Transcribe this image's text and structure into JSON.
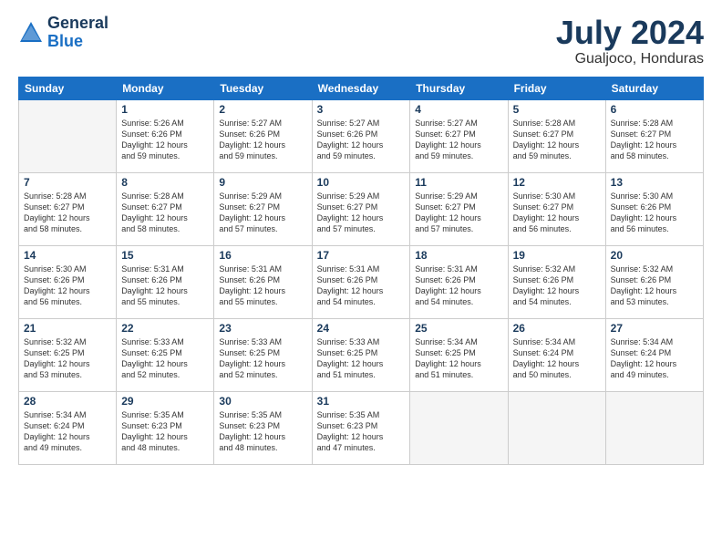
{
  "logo": {
    "general": "General",
    "blue": "Blue"
  },
  "title": {
    "month": "July 2024",
    "location": "Gualjoco, Honduras"
  },
  "weekdays": [
    "Sunday",
    "Monday",
    "Tuesday",
    "Wednesday",
    "Thursday",
    "Friday",
    "Saturday"
  ],
  "weeks": [
    [
      {
        "day": "",
        "info": ""
      },
      {
        "day": "1",
        "info": "Sunrise: 5:26 AM\nSunset: 6:26 PM\nDaylight: 12 hours\nand 59 minutes."
      },
      {
        "day": "2",
        "info": "Sunrise: 5:27 AM\nSunset: 6:26 PM\nDaylight: 12 hours\nand 59 minutes."
      },
      {
        "day": "3",
        "info": "Sunrise: 5:27 AM\nSunset: 6:26 PM\nDaylight: 12 hours\nand 59 minutes."
      },
      {
        "day": "4",
        "info": "Sunrise: 5:27 AM\nSunset: 6:27 PM\nDaylight: 12 hours\nand 59 minutes."
      },
      {
        "day": "5",
        "info": "Sunrise: 5:28 AM\nSunset: 6:27 PM\nDaylight: 12 hours\nand 59 minutes."
      },
      {
        "day": "6",
        "info": "Sunrise: 5:28 AM\nSunset: 6:27 PM\nDaylight: 12 hours\nand 58 minutes."
      }
    ],
    [
      {
        "day": "7",
        "info": "Sunrise: 5:28 AM\nSunset: 6:27 PM\nDaylight: 12 hours\nand 58 minutes."
      },
      {
        "day": "8",
        "info": "Sunrise: 5:28 AM\nSunset: 6:27 PM\nDaylight: 12 hours\nand 58 minutes."
      },
      {
        "day": "9",
        "info": "Sunrise: 5:29 AM\nSunset: 6:27 PM\nDaylight: 12 hours\nand 57 minutes."
      },
      {
        "day": "10",
        "info": "Sunrise: 5:29 AM\nSunset: 6:27 PM\nDaylight: 12 hours\nand 57 minutes."
      },
      {
        "day": "11",
        "info": "Sunrise: 5:29 AM\nSunset: 6:27 PM\nDaylight: 12 hours\nand 57 minutes."
      },
      {
        "day": "12",
        "info": "Sunrise: 5:30 AM\nSunset: 6:27 PM\nDaylight: 12 hours\nand 56 minutes."
      },
      {
        "day": "13",
        "info": "Sunrise: 5:30 AM\nSunset: 6:26 PM\nDaylight: 12 hours\nand 56 minutes."
      }
    ],
    [
      {
        "day": "14",
        "info": "Sunrise: 5:30 AM\nSunset: 6:26 PM\nDaylight: 12 hours\nand 56 minutes."
      },
      {
        "day": "15",
        "info": "Sunrise: 5:31 AM\nSunset: 6:26 PM\nDaylight: 12 hours\nand 55 minutes."
      },
      {
        "day": "16",
        "info": "Sunrise: 5:31 AM\nSunset: 6:26 PM\nDaylight: 12 hours\nand 55 minutes."
      },
      {
        "day": "17",
        "info": "Sunrise: 5:31 AM\nSunset: 6:26 PM\nDaylight: 12 hours\nand 54 minutes."
      },
      {
        "day": "18",
        "info": "Sunrise: 5:31 AM\nSunset: 6:26 PM\nDaylight: 12 hours\nand 54 minutes."
      },
      {
        "day": "19",
        "info": "Sunrise: 5:32 AM\nSunset: 6:26 PM\nDaylight: 12 hours\nand 54 minutes."
      },
      {
        "day": "20",
        "info": "Sunrise: 5:32 AM\nSunset: 6:26 PM\nDaylight: 12 hours\nand 53 minutes."
      }
    ],
    [
      {
        "day": "21",
        "info": "Sunrise: 5:32 AM\nSunset: 6:25 PM\nDaylight: 12 hours\nand 53 minutes."
      },
      {
        "day": "22",
        "info": "Sunrise: 5:33 AM\nSunset: 6:25 PM\nDaylight: 12 hours\nand 52 minutes."
      },
      {
        "day": "23",
        "info": "Sunrise: 5:33 AM\nSunset: 6:25 PM\nDaylight: 12 hours\nand 52 minutes."
      },
      {
        "day": "24",
        "info": "Sunrise: 5:33 AM\nSunset: 6:25 PM\nDaylight: 12 hours\nand 51 minutes."
      },
      {
        "day": "25",
        "info": "Sunrise: 5:34 AM\nSunset: 6:25 PM\nDaylight: 12 hours\nand 51 minutes."
      },
      {
        "day": "26",
        "info": "Sunrise: 5:34 AM\nSunset: 6:24 PM\nDaylight: 12 hours\nand 50 minutes."
      },
      {
        "day": "27",
        "info": "Sunrise: 5:34 AM\nSunset: 6:24 PM\nDaylight: 12 hours\nand 49 minutes."
      }
    ],
    [
      {
        "day": "28",
        "info": "Sunrise: 5:34 AM\nSunset: 6:24 PM\nDaylight: 12 hours\nand 49 minutes."
      },
      {
        "day": "29",
        "info": "Sunrise: 5:35 AM\nSunset: 6:23 PM\nDaylight: 12 hours\nand 48 minutes."
      },
      {
        "day": "30",
        "info": "Sunrise: 5:35 AM\nSunset: 6:23 PM\nDaylight: 12 hours\nand 48 minutes."
      },
      {
        "day": "31",
        "info": "Sunrise: 5:35 AM\nSunset: 6:23 PM\nDaylight: 12 hours\nand 47 minutes."
      },
      {
        "day": "",
        "info": ""
      },
      {
        "day": "",
        "info": ""
      },
      {
        "day": "",
        "info": ""
      }
    ]
  ]
}
